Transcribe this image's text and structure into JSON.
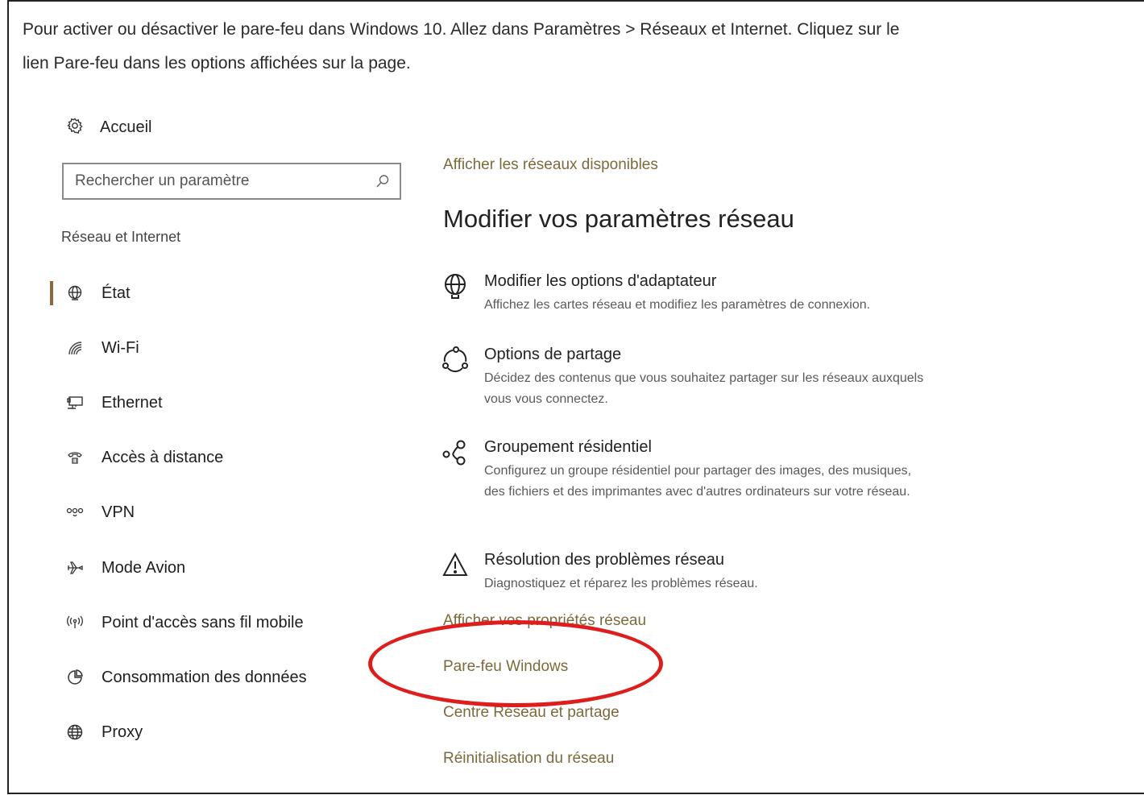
{
  "intro": {
    "line1": "Pour activer ou désactiver le pare-feu dans Windows 10. Allez dans Paramètres > Réseaux et Internet. Cliquez sur le",
    "line2": "lien Pare-feu dans les options affichées sur la page."
  },
  "sidebar": {
    "home_label": "Accueil",
    "search_placeholder": "Rechercher un paramètre",
    "section_label": "Réseau et Internet",
    "items": [
      {
        "label": "État",
        "icon": "globe-status-icon",
        "active": true
      },
      {
        "label": "Wi-Fi",
        "icon": "wifi-icon"
      },
      {
        "label": "Ethernet",
        "icon": "ethernet-icon"
      },
      {
        "label": "Accès à distance",
        "icon": "dialup-phone-icon"
      },
      {
        "label": "VPN",
        "icon": "vpn-icon"
      },
      {
        "label": "Mode Avion",
        "icon": "airplane-icon"
      },
      {
        "label": "Point d'accès sans fil mobile",
        "icon": "hotspot-icon"
      },
      {
        "label": "Consommation des données",
        "icon": "data-usage-icon"
      },
      {
        "label": "Proxy",
        "icon": "globe-icon"
      }
    ]
  },
  "main": {
    "available_networks_link": "Afficher les réseaux disponibles",
    "heading": "Modifier vos paramètres réseau",
    "options": [
      {
        "title": "Modifier les options d'adaptateur",
        "desc": "Affichez les cartes réseau et modifiez les paramètres de connexion.",
        "icon": "adapter-globe-icon"
      },
      {
        "title": "Options de partage",
        "desc": "Décidez des contenus que vous souhaitez partager sur les réseaux auxquels vous vous connectez.",
        "icon": "sharing-icon"
      },
      {
        "title": "Groupement résidentiel",
        "desc": "Configurez un groupe résidentiel pour partager des images, des musiques, des fichiers et des imprimantes avec d'autres ordinateurs sur votre réseau.",
        "icon": "homegroup-icon"
      },
      {
        "title": "Résolution des problèmes réseau",
        "desc": "Diagnostiquez et réparez les problèmes réseau.",
        "icon": "warning-icon"
      }
    ],
    "links": {
      "properties": "Afficher vos propriétés réseau",
      "firewall": "Pare-feu Windows",
      "network_center": "Centre Réseau et partage",
      "reset": "Réinitialisation du réseau"
    }
  },
  "colors": {
    "accent_link": "#7c6a3c",
    "highlight_circle": "#e01d1d",
    "active_bar": "#8a6a3a"
  }
}
